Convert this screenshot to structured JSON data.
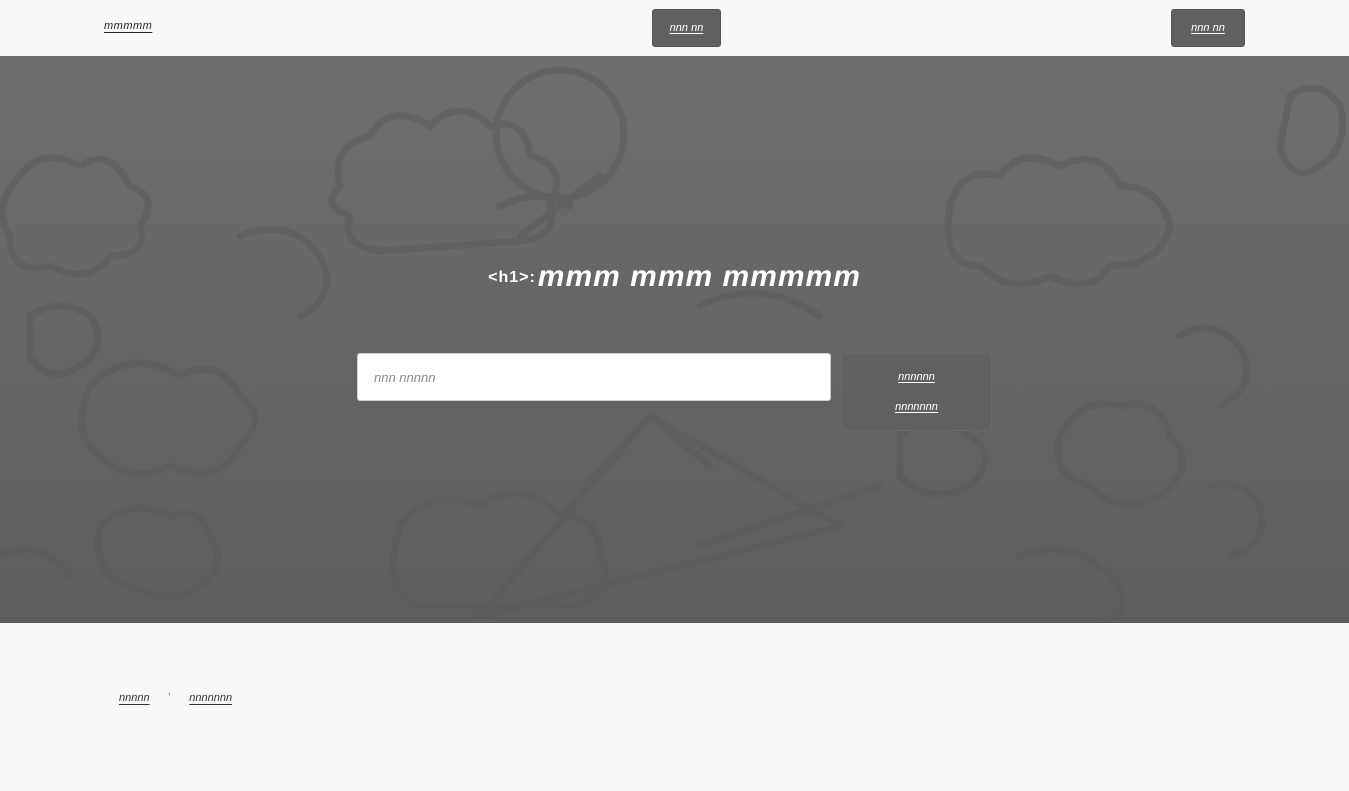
{
  "header": {
    "logo_text": "mmmmm",
    "center_button_label": "nnn nn",
    "right_button_label": "nnn nn"
  },
  "hero": {
    "title_tag": "<h1>:",
    "title_text": "mmm mmm mmmmm",
    "search_placeholder": "nnn nnnnn",
    "search_value": "",
    "search_button_line1": "nnnnnn",
    "search_button_line2": "nnnnnnn"
  },
  "footer": {
    "link_1": "nnnnn",
    "separator": "·",
    "link_2": "nnnnnnn"
  },
  "colors": {
    "page_bg": "#f8f8f8",
    "hero_bg": "#666666",
    "button_bg": "#606060",
    "button_text": "#ffffff"
  }
}
